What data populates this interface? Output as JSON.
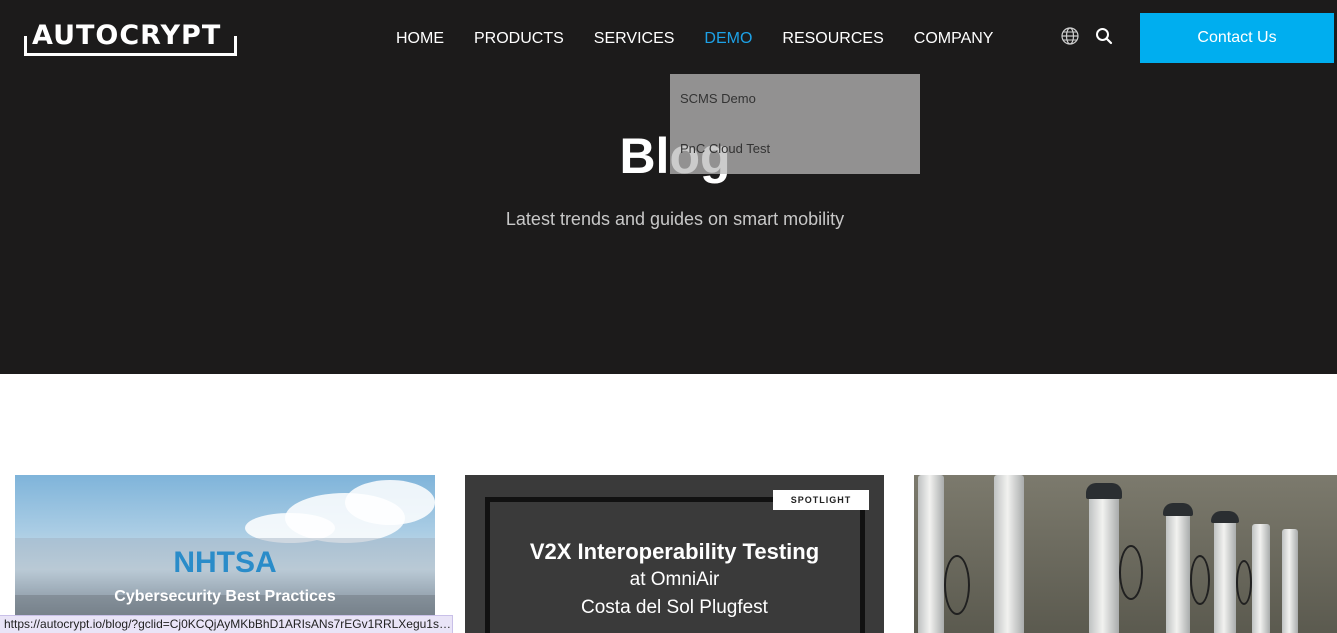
{
  "header": {
    "logo_text": "AUTOCRYPT",
    "nav": [
      {
        "label": "HOME"
      },
      {
        "label": "PRODUCTS"
      },
      {
        "label": "SERVICES"
      },
      {
        "label": "DEMO",
        "active": true
      },
      {
        "label": "RESOURCES"
      },
      {
        "label": "COMPANY"
      }
    ],
    "icons": [
      "globe-icon",
      "search-icon"
    ],
    "contact_label": "Contact Us"
  },
  "dropdown": {
    "items": [
      {
        "label": "SCMS Demo"
      },
      {
        "label": "PnC Cloud Test"
      }
    ]
  },
  "hero": {
    "title": "Blog",
    "subtitle": "Latest trends and guides on smart mobility"
  },
  "cards": [
    {
      "title": "NHTSA",
      "subtitle": "Cybersecurity Best Practices"
    },
    {
      "badge": "SPOTLIGHT",
      "title": "V2X Interoperability Testing",
      "line2": "at OmniAir",
      "line3": "Costa del Sol Plugfest"
    },
    {}
  ],
  "status_bar": {
    "url": "https://autocrypt.io/blog/?gclid=Cj0KCQjAyMKbBhD1ARIsANs7rEGv1RRLXegu1sb..."
  },
  "colors": {
    "hero_bg": "#1c1b1b",
    "accent": "#00aeef",
    "nav_active": "#1da1e6"
  }
}
